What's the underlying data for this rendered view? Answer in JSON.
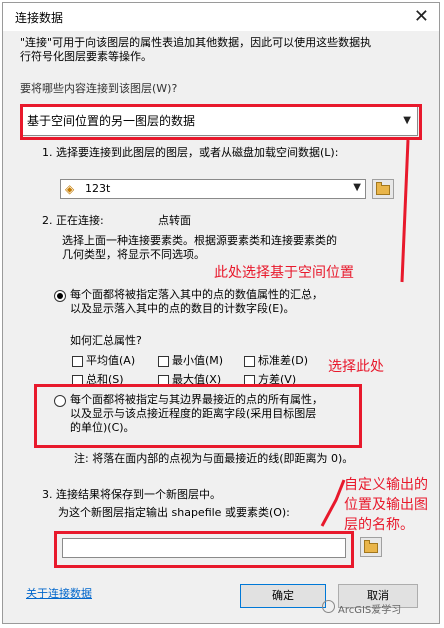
{
  "window": {
    "title": "连接数据",
    "close": "✕"
  },
  "intro": {
    "line1": "\"连接\"可用于向该图层的属性表追加其他数据，因此可以使用这些数据执",
    "line2": "行符号化图层要素等操作。"
  },
  "join_type": {
    "label": "要将哪些内容连接到该图层(W)?",
    "selected": "基于空间位置的另一图层的数据"
  },
  "step1": {
    "label": "1. 选择要连接到此图层的图层，或者从磁盘加载空间数据(L):",
    "layer_value": "123t"
  },
  "step2": {
    "label": "2. 正在连接:",
    "layer_type": "点转面",
    "desc1": "选择上面一种连接要素类。根据源要素类和连接要素类的",
    "desc2": "几何类型，将显示不同选项。",
    "option1_line1": "每个面都将被指定落入其中的点的数值属性的汇总，",
    "option1_line2": "以及显示落入其中的点的数目的计数字段(E)。",
    "summarize_label": "如何汇总属性?",
    "checkboxes": [
      {
        "label": "平均值(A)"
      },
      {
        "label": "最小值(M)"
      },
      {
        "label": "标准差(D)"
      },
      {
        "label": "总和(S)"
      },
      {
        "label": "最大值(X)"
      },
      {
        "label": "方差(V)"
      }
    ],
    "option2_line1": "每个面都将被指定与其边界最接近的点的所有属性，",
    "option2_line2": "以及显示与该点接近程度的距离字段(采用目标图层",
    "option2_line3": "的单位)(C)。",
    "note": "注: 将落在面内部的点视为与面最接近的线(即距离为 0)。"
  },
  "step3": {
    "label": "3. 连接结果将保存到一个新图层中。",
    "sub_label": "为这个新图层指定输出 shapefile 或要素类(O):",
    "output_value": ""
  },
  "footer": {
    "about_link": "关于连接数据",
    "ok": "确定",
    "cancel": "取消",
    "watermark": "ArcGIS爱学习"
  },
  "annotations": {
    "spatial": "此处选择基于空间位置",
    "select_here": "选择此处",
    "custom_line1": "自定义输出的",
    "custom_line2": "位置及输出图",
    "custom_line3": "层的名称。"
  },
  "colors": {
    "annotation_red": "#e8192c",
    "dialog_bg": "#f0f0f0",
    "link_blue": "#0066cc"
  }
}
